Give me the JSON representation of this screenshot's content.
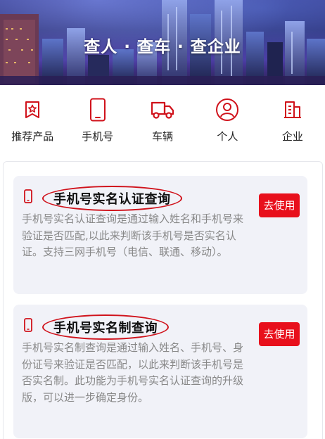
{
  "banner": {
    "title": "查人 · 查车 · 查企业"
  },
  "nav": {
    "items": [
      {
        "label": "推荐产品",
        "icon": "recommend-star-icon"
      },
      {
        "label": "手机号",
        "icon": "mobile-phone-icon"
      },
      {
        "label": "车辆",
        "icon": "truck-icon"
      },
      {
        "label": "个人",
        "icon": "person-icon"
      },
      {
        "label": "企业",
        "icon": "enterprise-building-icon"
      }
    ]
  },
  "cards": [
    {
      "title": "手机号实名认证查询",
      "button": "去使用",
      "icon": "mobile-phone-icon",
      "description": "手机号实名认证查询是通过输入姓名和手机号来验证是否匹配,以此来判断该手机号是否实名认证。支持三网手机号（电信、联通、移动）。"
    },
    {
      "title": "手机号实名制查询",
      "button": "去使用",
      "icon": "mobile-phone-icon",
      "description": "手机号实名制查询是通过输入姓名、手机号、身份证号来验证是否匹配，以此来判断该手机号是否实名制。此功能为手机号实名认证查询的升级版，可以进一步确定身份。"
    }
  ],
  "colors": {
    "accent": "#e8101c",
    "icon": "#d0121b",
    "card_bg": "#f1f2f8",
    "desc_text": "#888888"
  }
}
